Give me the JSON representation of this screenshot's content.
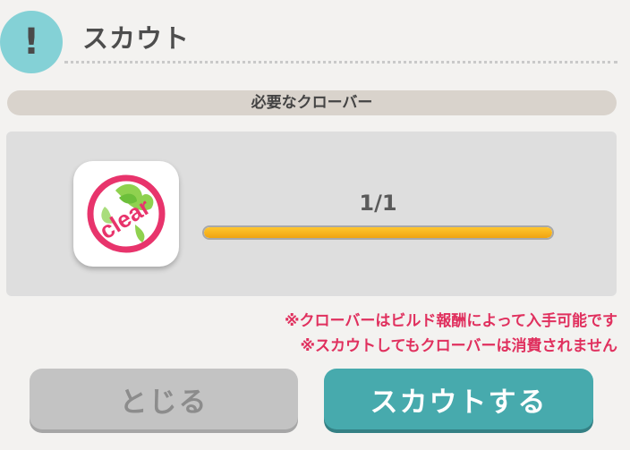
{
  "dialog": {
    "title": "スカウト",
    "section_header": "必要なクローバー",
    "item": {
      "icon": "clear-clover-icon",
      "logo_text": "clear",
      "count_text": "1/1",
      "progress_fraction": 1.0
    },
    "notes": [
      "※クローバーはビルド報酬によって入手可能です",
      "※スカウトしてもクローバーは消費されません"
    ],
    "buttons": {
      "close_label": "とじる",
      "scout_label": "スカウトする"
    }
  },
  "colors": {
    "accent": "#47aaad",
    "icon_circle": "#84d1d6",
    "note_text": "#e0305e",
    "progress": "#f5b11e"
  }
}
